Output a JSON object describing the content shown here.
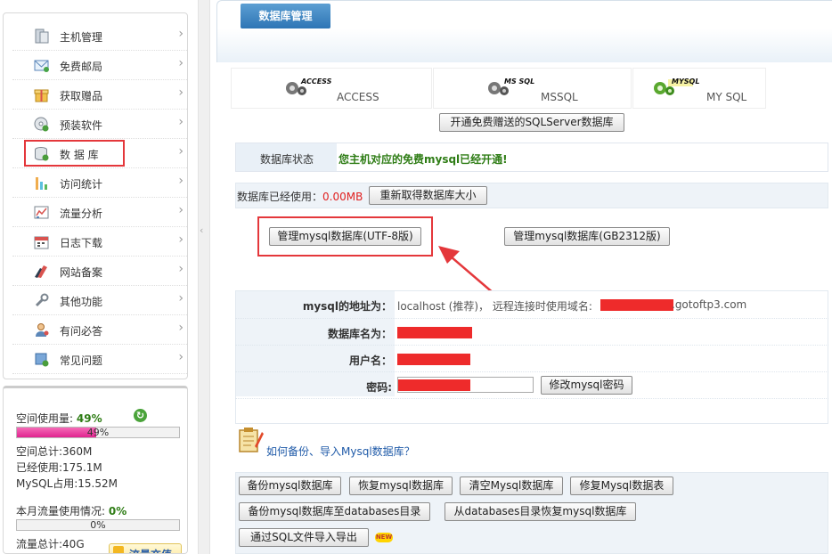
{
  "sidebar": {
    "items": [
      {
        "label": "主机管理",
        "icon": "server-icon"
      },
      {
        "label": "免费邮局",
        "icon": "mail-icon"
      },
      {
        "label": "获取赠品",
        "icon": "gift-box-icon"
      },
      {
        "label": "预装软件",
        "icon": "software-disc-icon"
      },
      {
        "label": "数 据 库",
        "icon": "database-icon"
      },
      {
        "label": "访问统计",
        "icon": "stats-bars-icon"
      },
      {
        "label": "流量分析",
        "icon": "chart-analysis-icon"
      },
      {
        "label": "日志下载",
        "icon": "calendar-icon"
      },
      {
        "label": "网站备案",
        "icon": "flag-icon"
      },
      {
        "label": "其他功能",
        "icon": "wrench-icon"
      },
      {
        "label": "有问必答",
        "icon": "user-support-icon"
      },
      {
        "label": "常见问题",
        "icon": "faq-box-icon"
      }
    ],
    "arrow": "›"
  },
  "usage": {
    "space_used_label": "空间使用量:",
    "space_used_pct": "49%",
    "space_used_fraction": 0.49,
    "space_bar_text": "49%",
    "space_total": "空间总计:360M",
    "space_used": "已经使用:175.1M",
    "mysql_used": "MySQL占用:15.52M",
    "traffic_label": "本月流量使用情况:",
    "traffic_pct": "0%",
    "traffic_fraction": 0,
    "traffic_bar_text": "0%",
    "traffic_total": "流量总计:40G",
    "recharge_label": "流量充值"
  },
  "main": {
    "title": "数据库管理",
    "tabs": [
      {
        "badge": "ACCESS",
        "label": "ACCESS"
      },
      {
        "badge": "MS SQL",
        "label": "MSSQL"
      },
      {
        "badge": "MYSQL",
        "label": "MY SQL"
      }
    ],
    "open_sqlserver_button": "开通免费赠送的SQLServer数据库",
    "status_label": "数据库状态",
    "status_text": "您主机对应的免费mysql已经开通!",
    "db_used_label": "数据库已经使用：",
    "db_used_value": "0.00MB",
    "refresh_size_button": "重新取得数据库大小",
    "manage_utf8_button": "管理mysql数据库(UTF-8版)",
    "manage_gb2312_button": "管理mysql数据库(GB2312版)",
    "address_label": "mysql的地址为：",
    "address_value": "localhost (推荐)，  远程连接时使用域名:",
    "address_domain_suffix": ".gotoftp3.com",
    "dbname_label": "数据库名为：",
    "username_label": "用户名：",
    "password_label": "密码:",
    "change_password_button": "修改mysql密码",
    "backup_help_link": "如何备份、导入Mysql数据库？",
    "actions": {
      "backup": "备份mysql数据库",
      "restore": "恢复mysql数据库",
      "clear": "清空Mysql数据库",
      "repair": "修复Mysql数据表",
      "backup_to_dir": "备份mysql数据库至databases目录",
      "restore_from_dir": "从databases目录恢复mysql数据库",
      "sql_import_export": "通过SQL文件导入导出",
      "new_badge": "NEW"
    }
  },
  "colors": {
    "annotation_red": "#e4373b",
    "status_green": "#2f7d16",
    "used_red": "#e02020",
    "title_blue": "#2e75b5",
    "progress_pink": "#e0238f"
  }
}
